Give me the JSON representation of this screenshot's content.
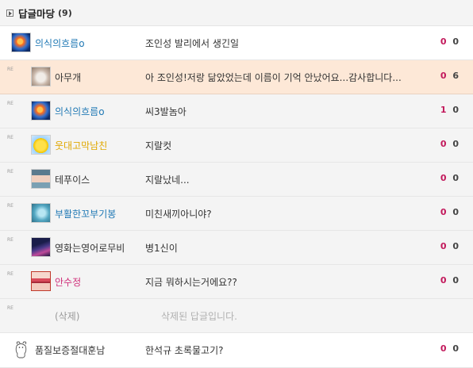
{
  "header": {
    "title": "답글마당",
    "count": "(9)"
  },
  "colors": {
    "nick_blue": "#1f78b4",
    "nick_dark": "#333333",
    "nick_yellow": "#e0a800",
    "nick_pink": "#d0307a",
    "vote_up": "#c2185b",
    "vote_down": "#444444",
    "highlight_row": "#fde8d7"
  },
  "reply_tag": "RE",
  "comments": [
    {
      "avatar_icon": "fire-avatar-icon",
      "nick": "의식의흐름o",
      "text": "조인성 발리에서 생긴일",
      "up": "0",
      "down": "0"
    },
    {
      "avatar_icon": "cat-avatar-icon",
      "nick": "아무개",
      "text": "아 조인성!저랑 닮았었는데 이름이 기억 안났어요...감사합니다...",
      "up": "0",
      "down": "6"
    },
    {
      "avatar_icon": "fire-avatar-icon",
      "nick": "의식의흐름o",
      "text": "씨3발놈아",
      "up": "1",
      "down": "0"
    },
    {
      "avatar_icon": "pikachu-avatar-icon",
      "nick": "웃대고막남친",
      "text": "지랄컷",
      "up": "0",
      "down": "0"
    },
    {
      "avatar_icon": "girl-avatar-icon",
      "nick": "테푸이스",
      "text": "지랄났네...",
      "up": "0",
      "down": "0"
    },
    {
      "avatar_icon": "blue-character-avatar-icon",
      "nick": "부활한꼬부기봉",
      "text": "미친새끼아니야?",
      "up": "0",
      "down": "0"
    },
    {
      "avatar_icon": "night-sky-avatar-icon",
      "nick": "영화는영어로무비",
      "text": "병1신이",
      "up": "0",
      "down": "0"
    },
    {
      "avatar_icon": "lips-avatar-icon",
      "nick": "안수정",
      "text": "지금 뭐하시는거에요??",
      "up": "0",
      "down": "0"
    },
    {
      "nick": "(삭제)",
      "text": "삭제된 답글입니다."
    },
    {
      "avatar_icon": "bear-avatar-icon",
      "nick": "품질보증절대훈남",
      "text": "한석규 초록물고기?",
      "up": "0",
      "down": "0"
    }
  ]
}
